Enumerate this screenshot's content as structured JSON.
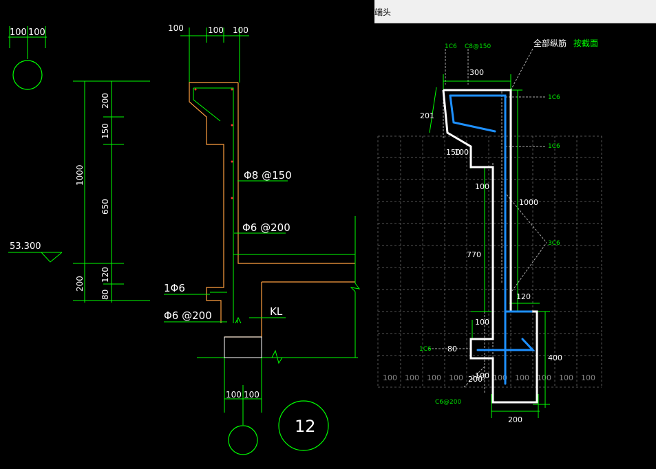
{
  "left": {
    "top_left_dims": [
      "100",
      "100"
    ],
    "elev_text": "53.300",
    "vert_dims": [
      "200",
      "150",
      "650",
      "120",
      "80"
    ],
    "total_dim": "1000",
    "lower_dim": "200",
    "top_dims": [
      "100",
      "100",
      "100"
    ],
    "labels": {
      "rebar1": "Φ8 @150",
      "rebar2": "Φ6 @200",
      "rebar3": "1Φ6",
      "rebar4": "Φ6 @200",
      "beam": "KL"
    },
    "bottom_dims": [
      "100",
      "100"
    ],
    "circle_number": "12"
  },
  "right": {
    "window_title": "端头",
    "header": {
      "all_bars": "全部纵筋",
      "by_section": "按截面"
    },
    "labels": {
      "c6_top": "1C6",
      "c8_150": "C8@150",
      "d300": "300",
      "c6_r1": "1C6",
      "d201": "201",
      "c6_r2": "1C6",
      "d150": "150",
      "d100a": "100",
      "d100b": "100",
      "d1000": "1000",
      "c6_3": "3C6",
      "d770": "770",
      "d120": "120",
      "d100c": "100",
      "c6_left": "1C6",
      "d80": "80",
      "d400": "400",
      "d200a": "200",
      "d100d": "100",
      "c6_200": "C6@200",
      "d200b": "200"
    },
    "grid_labels": [
      "100",
      "100",
      "100",
      "100",
      "100",
      "100",
      "100",
      "100",
      "100",
      "100"
    ]
  },
  "colors": {
    "dim_green": "#00ff00",
    "outline_orange": "#ffa040",
    "text_white": "#ffffff",
    "section_white": "#ffffff",
    "rebar_blue": "#1e90ff",
    "label_green": "#00e000",
    "grid_gray": "#555555"
  }
}
